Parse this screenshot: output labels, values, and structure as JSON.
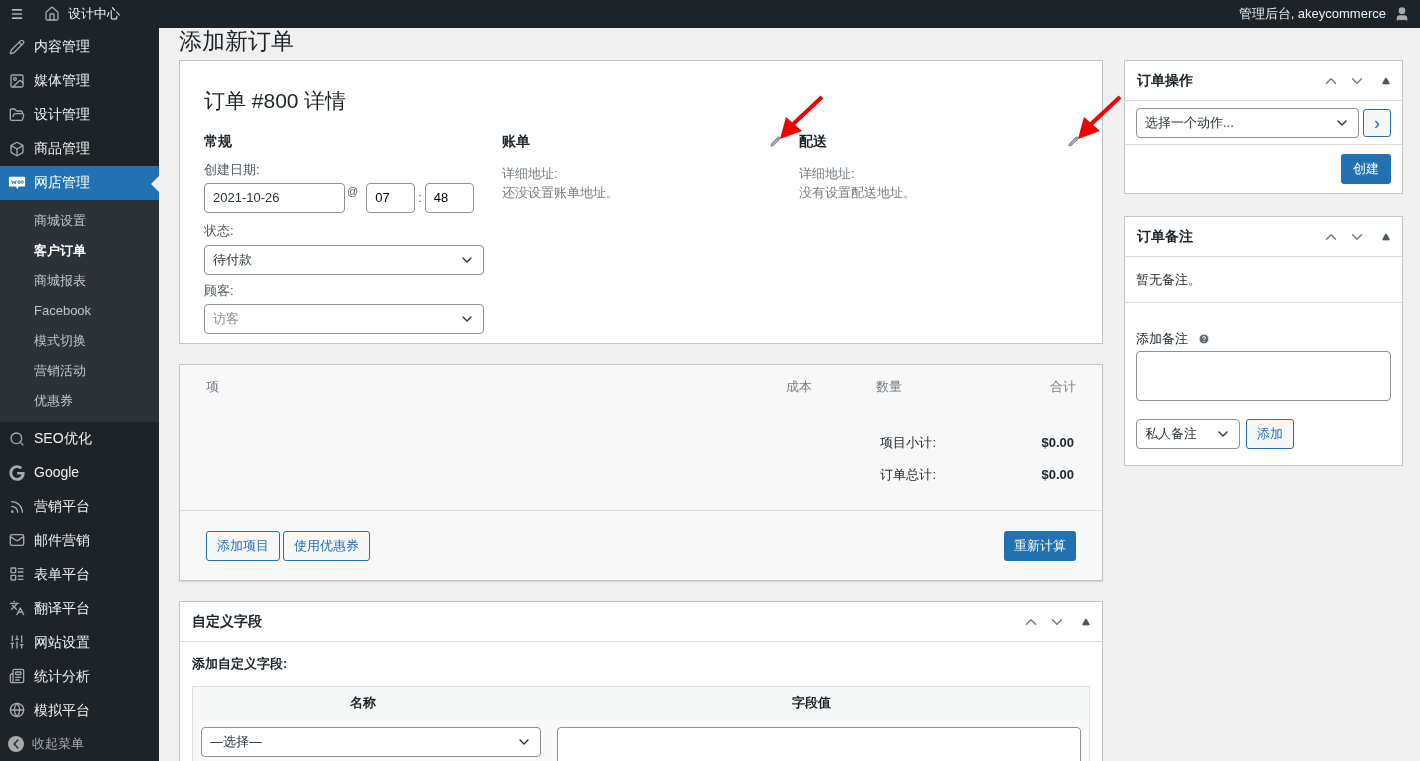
{
  "topbar": {
    "site_name": "设计中心",
    "account": "管理后台, akeycommerce"
  },
  "page_title": "添加新订单",
  "sidebar": {
    "items": [
      {
        "label": "内容管理",
        "selected": false
      },
      {
        "label": "媒体管理",
        "selected": false
      },
      {
        "label": "设计管理",
        "selected": false
      },
      {
        "label": "商品管理",
        "selected": false
      },
      {
        "label": "网店管理",
        "selected": true,
        "children": [
          {
            "label": "商城设置",
            "selected": false
          },
          {
            "label": "客户订单",
            "selected": true
          },
          {
            "label": "商城报表",
            "selected": false
          },
          {
            "label": "Facebook",
            "selected": false
          },
          {
            "label": "模式切换",
            "selected": false
          },
          {
            "label": "营销活动",
            "selected": false
          },
          {
            "label": "优惠券",
            "selected": false
          }
        ]
      },
      {
        "label": "SEO优化",
        "selected": false
      },
      {
        "label": "Google",
        "selected": false
      },
      {
        "label": "营销平台",
        "selected": false
      },
      {
        "label": "邮件营销",
        "selected": false
      },
      {
        "label": "表单平台",
        "selected": false
      },
      {
        "label": "翻译平台",
        "selected": false
      },
      {
        "label": "网站设置",
        "selected": false
      },
      {
        "label": "统计分析",
        "selected": false
      },
      {
        "label": "模拟平台",
        "selected": false
      }
    ],
    "collapse": "收起菜单"
  },
  "order": {
    "title": "订单 #800 详情",
    "general": {
      "heading": "常规",
      "date_label": "创建日期:",
      "date": "2021-10-26",
      "at": "@",
      "hour": "07",
      "colon": ":",
      "minute": "48",
      "status_label": "状态:",
      "status": "待付款",
      "customer_label": "顾客:",
      "customer_placeholder": "访客"
    },
    "billing": {
      "heading": "账单",
      "address_label": "详细地址:",
      "address": "还没设置账单地址。"
    },
    "shipping": {
      "heading": "配送",
      "address_label": "详细地址:",
      "address": "没有设置配送地址。"
    }
  },
  "items": {
    "columns": [
      "项",
      "成本",
      "数量",
      "合计"
    ],
    "totals": [
      {
        "label": "项目小计:",
        "value": "$0.00"
      },
      {
        "label": "订单总计:",
        "value": "$0.00"
      }
    ],
    "buttons": [
      "添加项目",
      "使用优惠券"
    ],
    "recalculate": "重新计算"
  },
  "custom_fields": {
    "title": "自定义字段",
    "add_label": "添加自定义字段:",
    "columns": [
      "名称",
      "字段值"
    ],
    "select": "—选择—"
  },
  "order_actions": {
    "title": "订单操作",
    "select": "选择一个动作...",
    "go": "›",
    "create": "创建"
  },
  "order_notes": {
    "title": "订单备注",
    "empty": "暂无备注。",
    "add_label": "添加备注",
    "note_type": "私人备注",
    "add": "添加"
  }
}
